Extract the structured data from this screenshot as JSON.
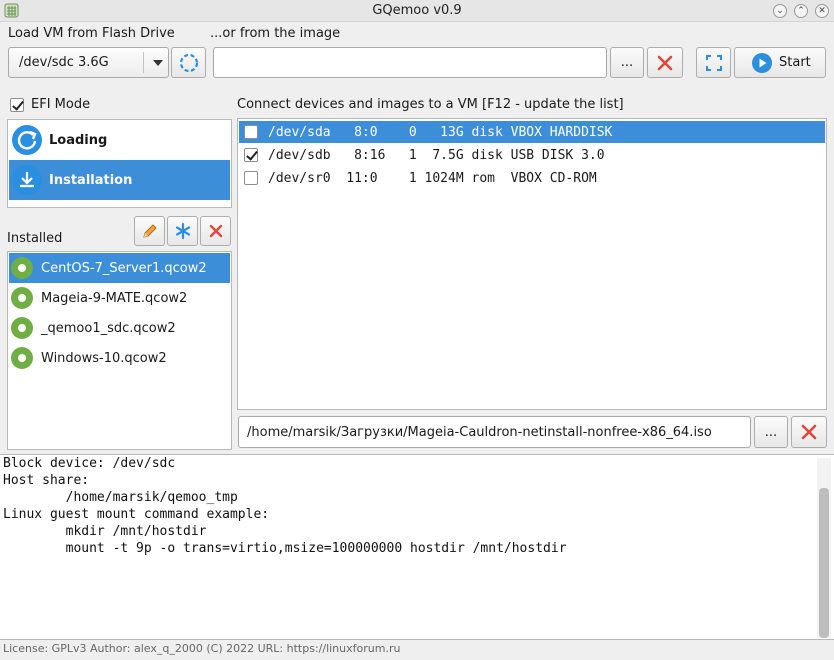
{
  "window": {
    "title": "GQemoo v0.9"
  },
  "top": {
    "flash_label": "Load VM from Flash Drive",
    "image_label": "...or from the image",
    "flash_selected": "/dev/sdc 3.6G",
    "image_value": "",
    "browse_label": "...",
    "start_label": "Start"
  },
  "left": {
    "efi_label": "EFI Mode",
    "efi_checked": true,
    "modes": [
      {
        "label": "Loading",
        "selected": false
      },
      {
        "label": "Installation",
        "selected": true
      }
    ],
    "installed_label": "Installed",
    "installed": [
      {
        "name": "CentOS-7_Server1.qcow2",
        "selected": true
      },
      {
        "name": "Mageia-9-MATE.qcow2",
        "selected": false
      },
      {
        "name": "_qemoo1_sdc.qcow2",
        "selected": false
      },
      {
        "name": "Windows-10.qcow2",
        "selected": false
      }
    ]
  },
  "right": {
    "devices_label": "Connect devices and images to a VM [F12 - update the list]",
    "devices": [
      {
        "text": "/dev/sda   8:0    0   13G disk VBOX HARDDISK",
        "checked": false,
        "selected": true
      },
      {
        "text": "/dev/sdb   8:16   1  7.5G disk USB DISK 3.0",
        "checked": true,
        "selected": false
      },
      {
        "text": "/dev/sr0  11:0    1 1024M rom  VBOX CD-ROM",
        "checked": false,
        "selected": false
      }
    ],
    "iso_path": "/home/marsik/Загрузки/Mageia-Cauldron-netinstall-nonfree-x86_64.iso",
    "browse_label": "..."
  },
  "log": {
    "lines": [
      "Block device: /dev/sdc",
      "Host share:",
      "        /home/marsik/qemoo_tmp",
      "Linux guest mount command example:",
      "        mkdir /mnt/hostdir",
      "        mount -t 9p -o trans=virtio,msize=100000000 hostdir /mnt/hostdir"
    ]
  },
  "status": {
    "text": "License: GPLv3   Author: alex_q_2000 (C) 2022   URL: https://linuxforum.ru"
  },
  "colors": {
    "accent": "#3d8ed9",
    "red_x": "#e0463a",
    "star_blue": "#2b8fe0",
    "dot_green": "#6fae42"
  },
  "icons": {
    "reload": "refresh-icon",
    "clear": "close-icon",
    "fullscreen": "fullscreen-icon",
    "start": "play-icon",
    "edit": "pencil-icon",
    "star": "asterisk-icon",
    "delete": "close-icon"
  }
}
